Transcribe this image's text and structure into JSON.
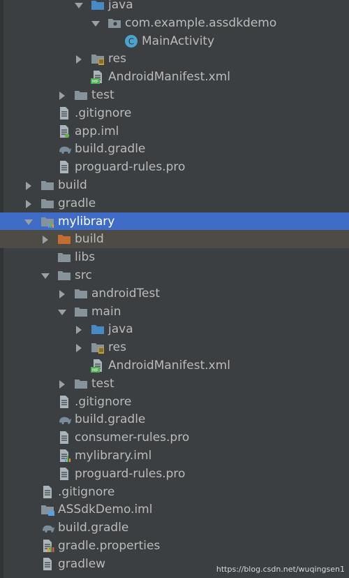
{
  "project_tree": {
    "rows": [
      {
        "label": "java",
        "kind": "folder-blue",
        "depth": 4,
        "expander": "expanded"
      },
      {
        "label": "com.example.assdkdemo",
        "kind": "package",
        "depth": 5,
        "expander": "expanded"
      },
      {
        "label": "MainActivity",
        "kind": "class",
        "depth": 6,
        "expander": "none"
      },
      {
        "label": "res",
        "kind": "folder-res",
        "depth": 4,
        "expander": "collapsed"
      },
      {
        "label": "AndroidManifest.xml",
        "kind": "manifest",
        "depth": 4,
        "expander": "none"
      },
      {
        "label": "test",
        "kind": "folder",
        "depth": 3,
        "expander": "collapsed"
      },
      {
        "label": ".gitignore",
        "kind": "file",
        "depth": 2,
        "expander": "none"
      },
      {
        "label": "app.iml",
        "kind": "file-iml",
        "depth": 2,
        "expander": "none"
      },
      {
        "label": "build.gradle",
        "kind": "gradle",
        "depth": 2,
        "expander": "none"
      },
      {
        "label": "proguard-rules.pro",
        "kind": "file",
        "depth": 2,
        "expander": "none"
      },
      {
        "label": "build",
        "kind": "folder",
        "depth": 1,
        "expander": "collapsed"
      },
      {
        "label": "gradle",
        "kind": "folder",
        "depth": 1,
        "expander": "collapsed"
      },
      {
        "label": "mylibrary",
        "kind": "module",
        "depth": 1,
        "expander": "expanded",
        "state": "selected"
      },
      {
        "label": "build",
        "kind": "folder-orange",
        "depth": 2,
        "expander": "collapsed",
        "state": "highlight"
      },
      {
        "label": "libs",
        "kind": "folder",
        "depth": 2,
        "expander": "none"
      },
      {
        "label": "src",
        "kind": "folder",
        "depth": 2,
        "expander": "expanded"
      },
      {
        "label": "androidTest",
        "kind": "folder",
        "depth": 3,
        "expander": "collapsed"
      },
      {
        "label": "main",
        "kind": "folder",
        "depth": 3,
        "expander": "expanded"
      },
      {
        "label": "java",
        "kind": "folder-blue",
        "depth": 4,
        "expander": "collapsed"
      },
      {
        "label": "res",
        "kind": "folder-res",
        "depth": 4,
        "expander": "collapsed"
      },
      {
        "label": "AndroidManifest.xml",
        "kind": "manifest",
        "depth": 4,
        "expander": "none"
      },
      {
        "label": "test",
        "kind": "folder",
        "depth": 3,
        "expander": "collapsed"
      },
      {
        "label": ".gitignore",
        "kind": "file",
        "depth": 2,
        "expander": "none"
      },
      {
        "label": "build.gradle",
        "kind": "gradle",
        "depth": 2,
        "expander": "none"
      },
      {
        "label": "consumer-rules.pro",
        "kind": "file",
        "depth": 2,
        "expander": "none"
      },
      {
        "label": "mylibrary.iml",
        "kind": "file-iml-chart",
        "depth": 2,
        "expander": "none"
      },
      {
        "label": "proguard-rules.pro",
        "kind": "file",
        "depth": 2,
        "expander": "none"
      },
      {
        "label": ".gitignore",
        "kind": "file",
        "depth": 1,
        "expander": "none"
      },
      {
        "label": "ASSdkDemo.iml",
        "kind": "folder-iml",
        "depth": 1,
        "expander": "none"
      },
      {
        "label": "build.gradle",
        "kind": "gradle",
        "depth": 1,
        "expander": "none"
      },
      {
        "label": "gradle.properties",
        "kind": "properties",
        "depth": 1,
        "expander": "none"
      },
      {
        "label": "gradlew",
        "kind": "file",
        "depth": 1,
        "expander": "none"
      }
    ]
  },
  "icons": {
    "expander-expanded": "triangle-down-icon",
    "expander-collapsed": "triangle-right-icon",
    "folder": "folder-icon",
    "folder-blue": "source-folder-icon",
    "folder-orange": "excluded-folder-icon",
    "folder-res": "resource-folder-icon",
    "package": "package-icon",
    "class": "class-icon",
    "manifest": "manifest-icon",
    "file": "text-file-icon",
    "file-iml": "module-file-icon",
    "file-iml-chart": "module-file-icon",
    "folder-iml": "module-file-icon",
    "gradle": "gradle-elephant-icon",
    "module": "module-icon",
    "properties": "properties-file-icon"
  },
  "colors": {
    "panel_bg": "#3c3f41",
    "selection": "#3f6cc7",
    "highlight": "#4e4a44",
    "text": "#bbbbbb",
    "folder": "#87939a",
    "source_folder": "#4a8ac4",
    "excluded_folder": "#c56d2f",
    "class_badge": "#4fa3c9",
    "gradle": "#7a8c9b"
  },
  "watermark": "https://blog.csdn.net/wuqingsen1"
}
